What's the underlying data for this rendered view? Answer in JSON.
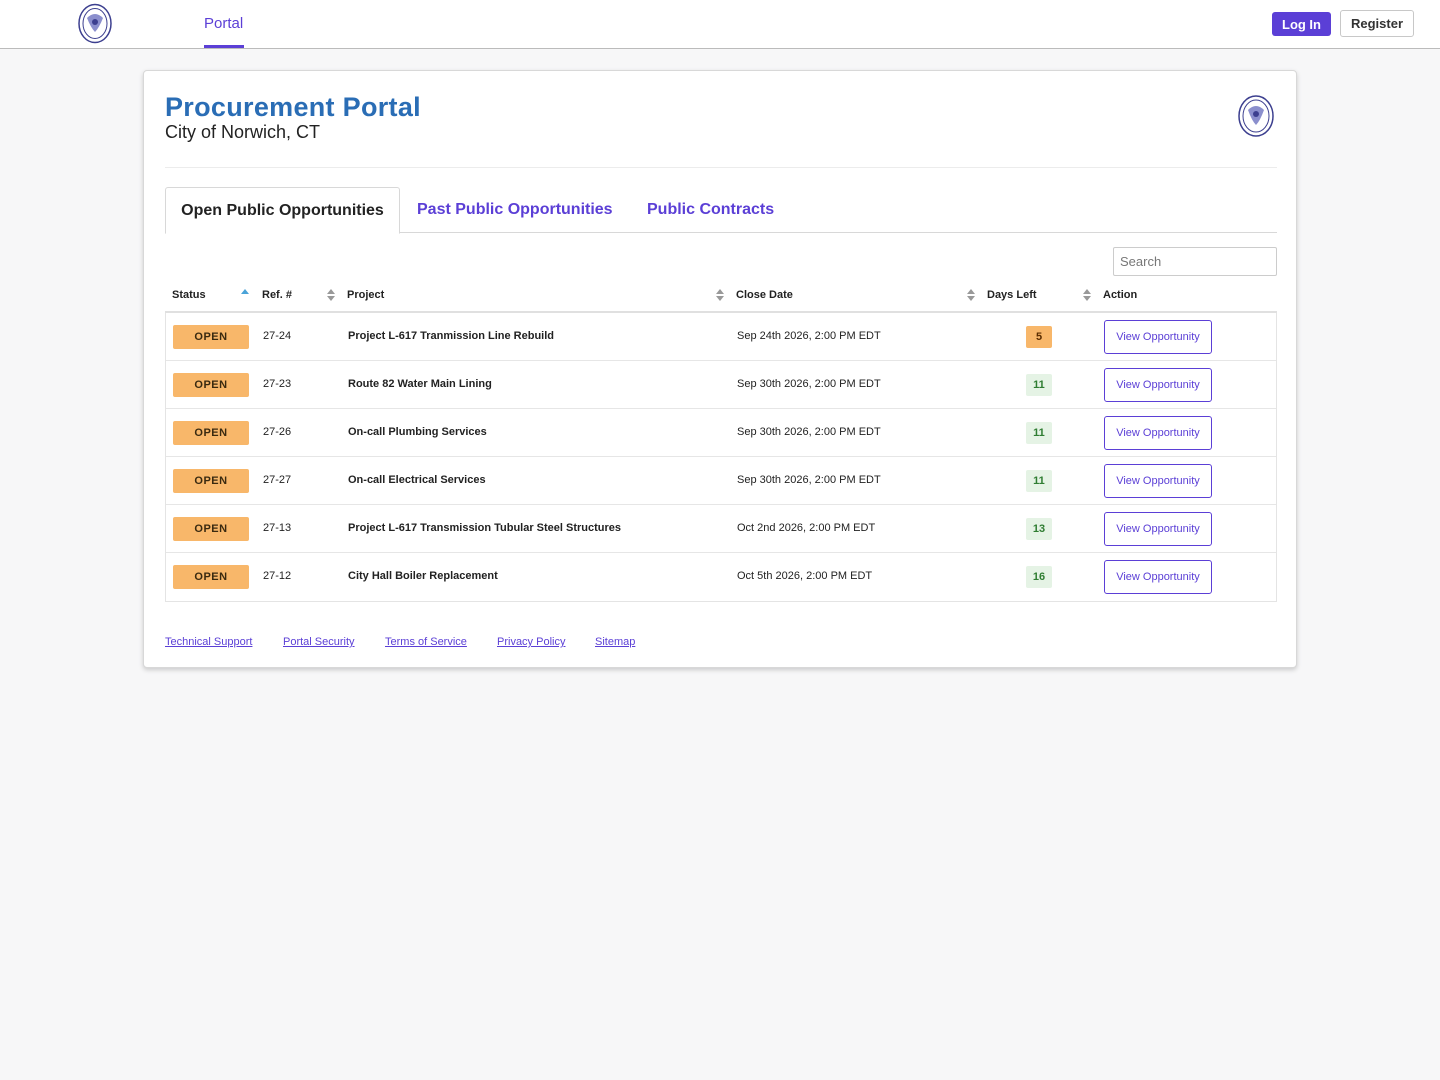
{
  "nav": {
    "portal_label": "Portal",
    "login_label": "Log In",
    "register_label": "Register"
  },
  "header": {
    "title": "Procurement Portal",
    "subtitle": "City of Norwich, CT"
  },
  "tabs": [
    {
      "label": "Open Public Opportunities",
      "active": true
    },
    {
      "label": "Past Public Opportunities",
      "active": false
    },
    {
      "label": "Public Contracts",
      "active": false
    }
  ],
  "search": {
    "placeholder": "Search"
  },
  "table": {
    "headers": [
      "Status",
      "Ref. #",
      "Project",
      "Close Date",
      "Days Left",
      "Action"
    ],
    "rows": [
      {
        "status": "OPEN",
        "ref": "27-24",
        "project": "Project L-617 Tranmission Line Rebuild",
        "close_date": "Sep 24th 2026, 2:00 PM EDT",
        "days_left": "5",
        "action": "View Opportunity"
      },
      {
        "status": "OPEN",
        "ref": "27-23",
        "project": "Route 82 Water Main Lining",
        "close_date": "Sep 30th 2026, 2:00 PM EDT",
        "days_left": "11",
        "action": "View Opportunity"
      },
      {
        "status": "OPEN",
        "ref": "27-26",
        "project": "On-call Plumbing Services",
        "close_date": "Sep 30th 2026, 2:00 PM EDT",
        "days_left": "11",
        "action": "View Opportunity"
      },
      {
        "status": "OPEN",
        "ref": "27-27",
        "project": "On-call Electrical Services",
        "close_date": "Sep 30th 2026, 2:00 PM EDT",
        "days_left": "11",
        "action": "View Opportunity"
      },
      {
        "status": "OPEN",
        "ref": "27-13",
        "project": "Project L-617 Transmission Tubular Steel Structures",
        "close_date": "Oct 2nd 2026, 2:00 PM EDT",
        "days_left": "13",
        "action": "View Opportunity"
      },
      {
        "status": "OPEN",
        "ref": "27-12",
        "project": "City Hall Boiler Replacement",
        "close_date": "Oct 5th 2026, 2:00 PM EDT",
        "days_left": "16",
        "action": "View Opportunity"
      }
    ]
  },
  "footer": {
    "links": [
      "Technical Support",
      "Portal Security",
      "Terms of Service",
      "Privacy Policy",
      "Sitemap"
    ]
  },
  "colors": {
    "accent": "#5b3fd6",
    "title": "#2a6db5",
    "open_status": "#f8b76a",
    "days_warn": "#f8b76a",
    "days_ok": "#e5f3e5"
  }
}
